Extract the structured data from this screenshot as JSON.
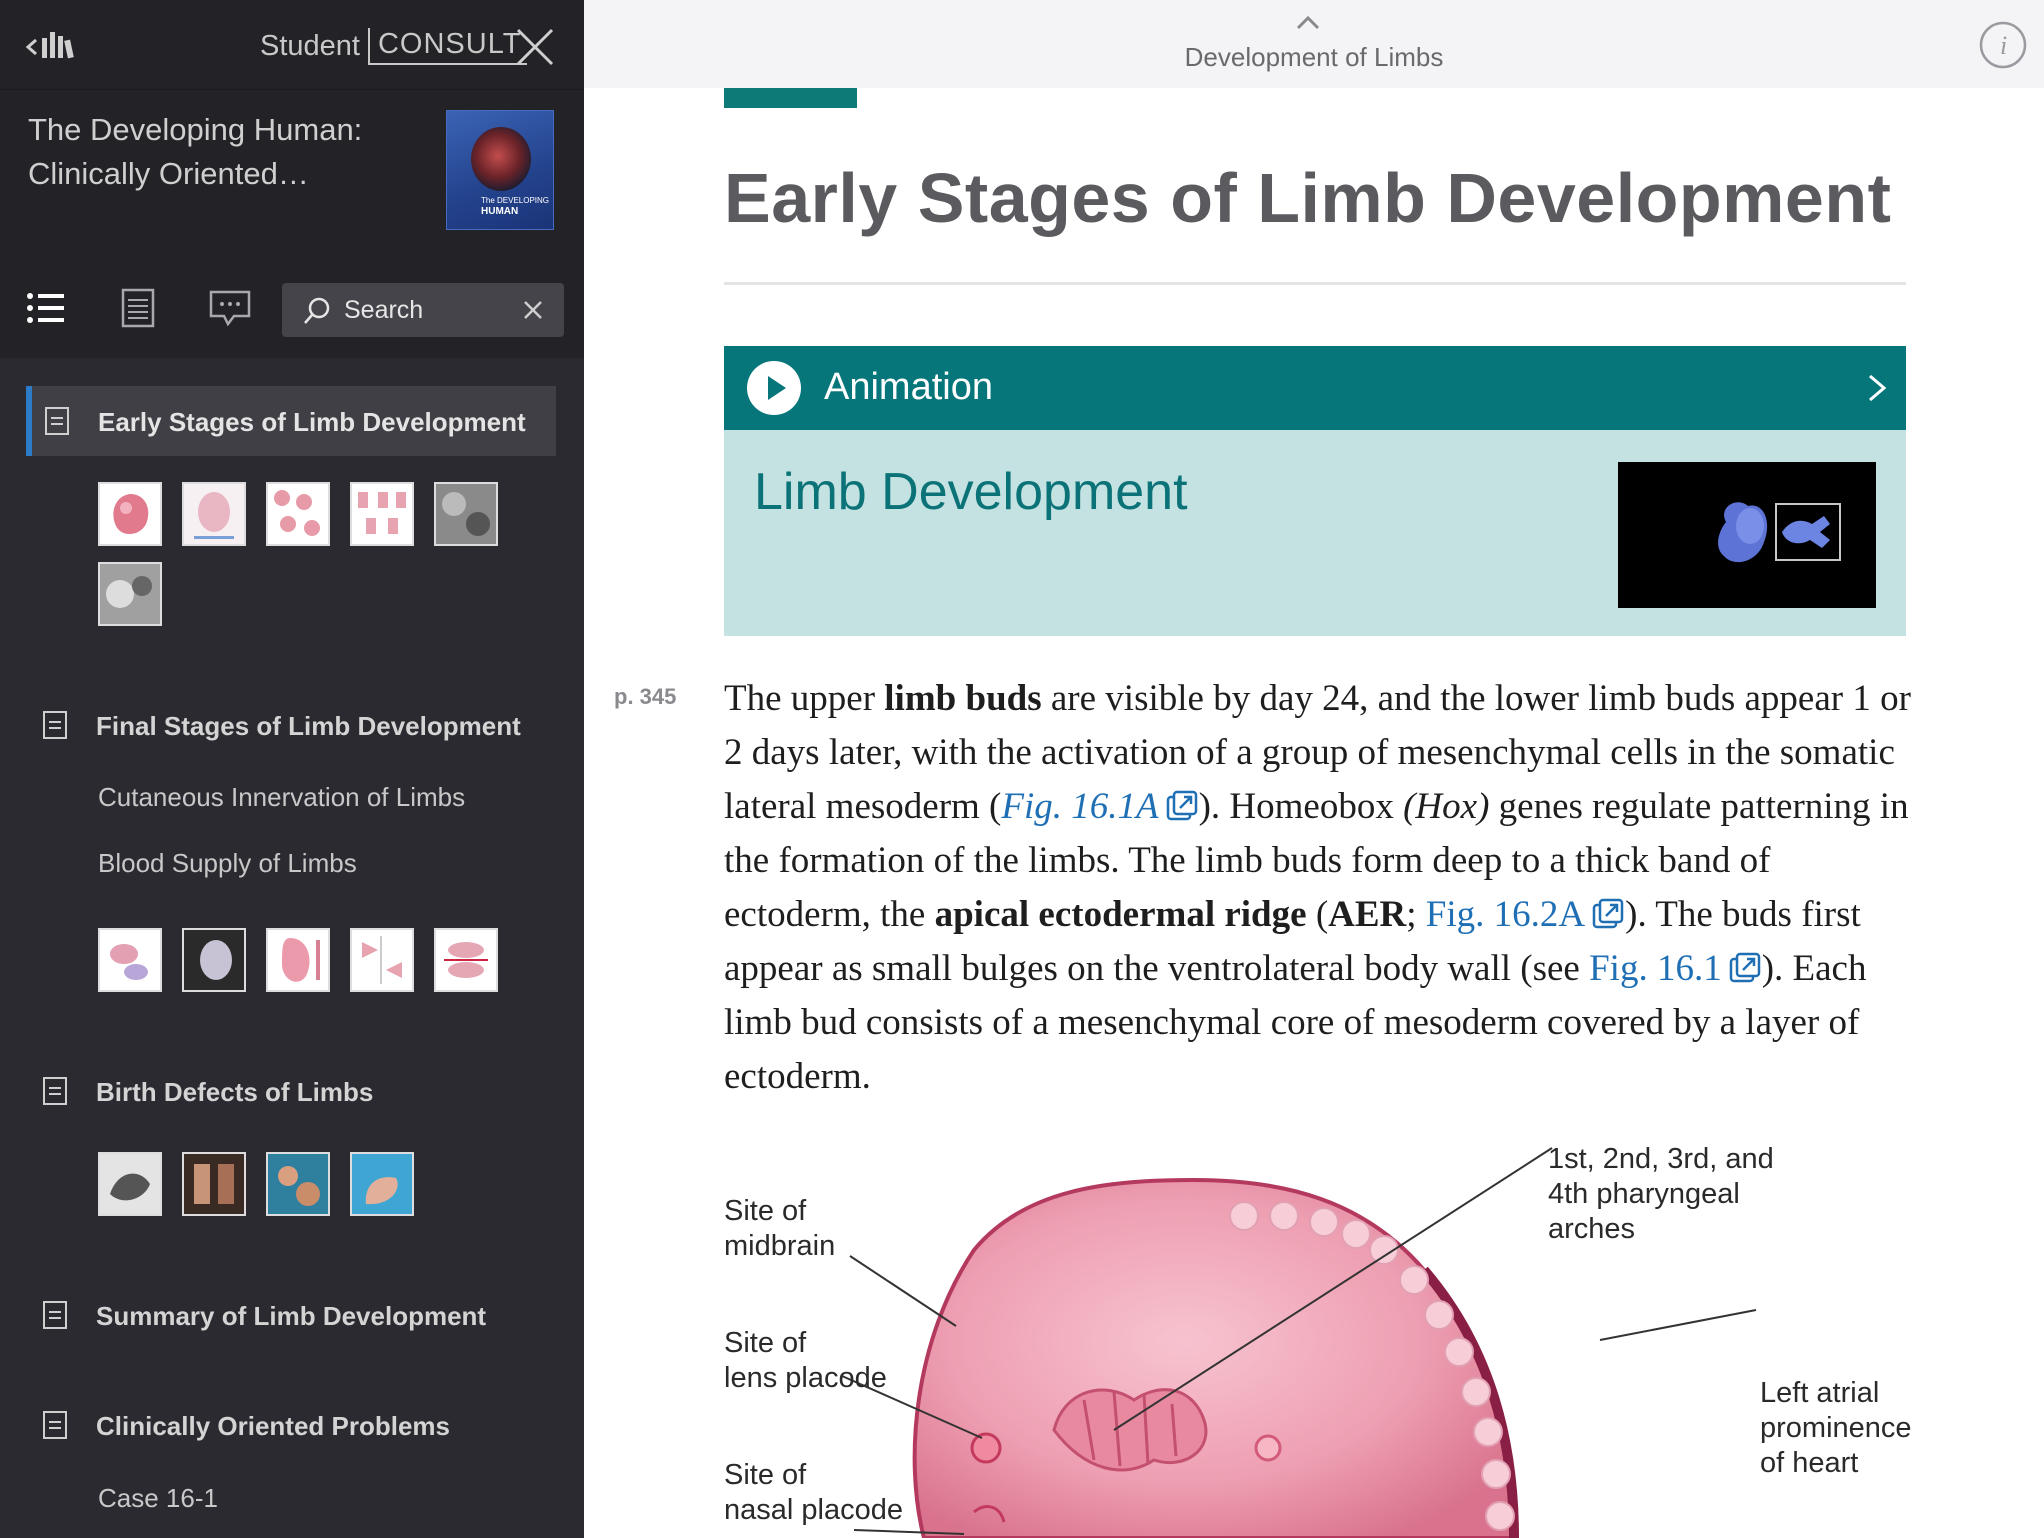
{
  "app": {
    "brand_student": "Student",
    "brand_consult": "CONSULT"
  },
  "book": {
    "title_line1": "The Developing Human:",
    "title_line2": "Clinically Oriented…",
    "cover_text_line1": "The DEVELOPING",
    "cover_text_line2": "HUMAN"
  },
  "search": {
    "placeholder": "Search"
  },
  "toc": {
    "selected_color": "#2b7bc6",
    "sections": [
      {
        "label": "Early Stages of Limb Development"
      },
      {
        "label": "Final Stages of Limb Development"
      },
      {
        "label": "Birth Defects of Limbs"
      },
      {
        "label": "Summary of Limb Development"
      },
      {
        "label": "Clinically Oriented Problems"
      }
    ],
    "subitems": [
      {
        "label": "Cutaneous Innervation of Limbs"
      },
      {
        "label": "Blood Supply of Limbs"
      },
      {
        "label": "Case 16-1"
      }
    ]
  },
  "topbar": {
    "chapter_title": "Development of Limbs"
  },
  "article": {
    "heading": "Early Stages of Limb Development",
    "animation_label": "Animation",
    "animation_title": "Limb Development",
    "page_number": "p. 345",
    "paragraph": {
      "t1": "The upper ",
      "b1": "limb buds",
      "t2": " are visible by day 24, and the lower limb buds appear 1 or 2 days later, with the activation of a group of mesenchymal cells in the somatic lateral mesoderm (",
      "link1": "Fig. 16.1A",
      "t3": "). Homeobox ",
      "i1": "(Hox)",
      "t4": " genes regulate patterning in the formation of the limbs. The limb buds form deep to a thick band of ectoderm, the ",
      "b2": "apical ectodermal ridge",
      "t5": " (",
      "b3": "AER",
      "t6": "; ",
      "link2": "Fig. 16.2A",
      "t7": "). The buds first appear as small bulges on the ventrolateral body wall (see ",
      "link3": "Fig. 16.1",
      "t8": "). Each limb bud consists of a mesenchymal core of mesoderm covered by a layer of ectoderm."
    },
    "figure_labels": {
      "midbrain": [
        "Site of",
        "midbrain"
      ],
      "lens": [
        "Site of",
        "lens placode"
      ],
      "nasal": [
        "Site of",
        "nasal placode"
      ],
      "arches": [
        "1st, 2nd, 3rd, and",
        "4th pharyngeal",
        "arches"
      ],
      "heart": [
        "Left atrial",
        "prominence",
        "of heart"
      ]
    }
  },
  "colors": {
    "teal": "#06767a",
    "teal_light": "#c4e2e2",
    "link": "#1f6fb5",
    "sidebar_bg": "#2b2a30"
  }
}
